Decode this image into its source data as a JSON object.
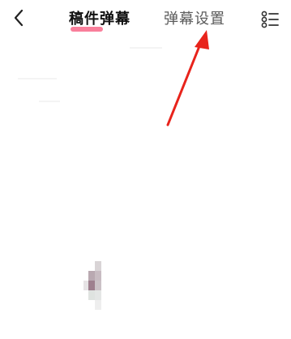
{
  "header": {
    "tabs": [
      {
        "label": "稿件弹幕",
        "active": true
      },
      {
        "label": "弹幕设置",
        "active": false
      }
    ]
  },
  "icons": {
    "back": "chevron-left-icon",
    "menu": "list-menu-icon"
  },
  "colors": {
    "active_tab_underline": "#f8698a",
    "annotation_arrow": "#e8231b",
    "active_tab_text": "#111111",
    "inactive_tab_text": "#5b5b5b"
  }
}
